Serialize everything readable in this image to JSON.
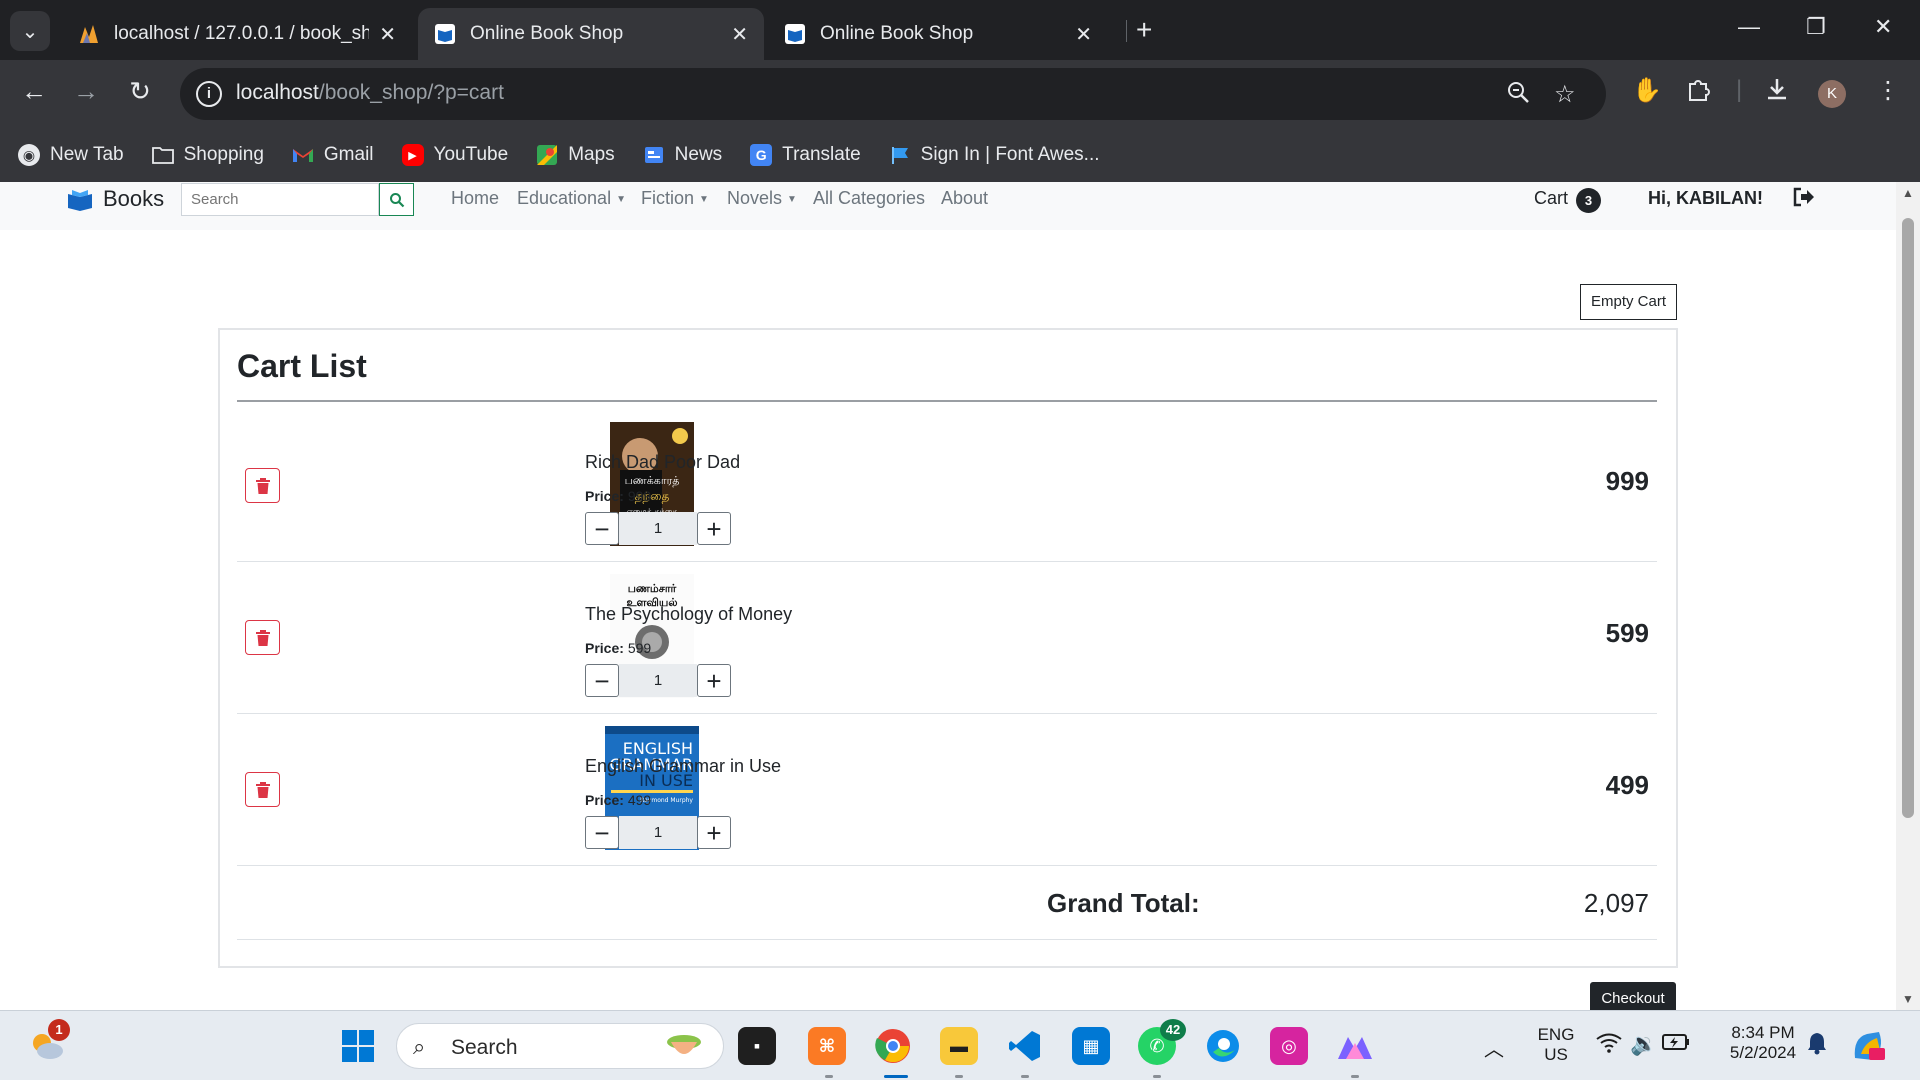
{
  "browser": {
    "tabs": [
      {
        "title": "localhost / 127.0.0.1 / book_sho",
        "favicon": "phpmyadmin-icon",
        "active": false
      },
      {
        "title": "Online Book Shop",
        "favicon": "book-shop-icon",
        "active": true
      },
      {
        "title": "Online Book Shop",
        "favicon": "book-shop-icon",
        "active": false
      }
    ],
    "address": {
      "host": "localhost",
      "path": "/book_shop/?p=cart"
    },
    "profile_initial": "K",
    "bookmarks": [
      {
        "label": "New Tab",
        "icon": "chrome-icon"
      },
      {
        "label": "Shopping",
        "icon": "folder-icon"
      },
      {
        "label": "Gmail",
        "icon": "gmail-icon"
      },
      {
        "label": "YouTube",
        "icon": "youtube-icon"
      },
      {
        "label": "Maps",
        "icon": "maps-icon"
      },
      {
        "label": "News",
        "icon": "news-icon"
      },
      {
        "label": "Translate",
        "icon": "translate-icon"
      },
      {
        "label": "Sign In | Font Awes...",
        "icon": "flag-icon"
      }
    ]
  },
  "site": {
    "brand": "Books",
    "search_placeholder": "Search",
    "nav": [
      {
        "label": "Home",
        "dropdown": false
      },
      {
        "label": "Educational",
        "dropdown": true
      },
      {
        "label": "Fiction",
        "dropdown": true
      },
      {
        "label": "Novels",
        "dropdown": true
      },
      {
        "label": "All Categories",
        "dropdown": false
      },
      {
        "label": "About",
        "dropdown": false
      }
    ],
    "cart_label": "Cart",
    "cart_count": "3",
    "greeting": "Hi, KABILAN!",
    "accent": "#198754",
    "danger": "#dc3545"
  },
  "cart": {
    "empty_button": "Empty Cart",
    "title": "Cart List",
    "items": [
      {
        "name": "Rich Dad Poor Dad",
        "price_label": "Price:",
        "price": "999",
        "qty": "1",
        "total": "999",
        "cover_lines": [
          "பணக்காரத்",
          "தந்தை",
          "ஏழைத் தந்தை"
        ]
      },
      {
        "name": "The Psychology of Money",
        "price_label": "Price:",
        "price": "599",
        "qty": "1",
        "total": "599",
        "cover_lines": [
          "பணம்சார்",
          "உளவியல்"
        ]
      },
      {
        "name": "English Grammar in Use",
        "price_label": "Price:",
        "price": "499",
        "qty": "1",
        "total": "499",
        "cover_lines": [
          "ENGLISH",
          "GRAMMAR",
          "IN USE",
          "Raymond Murphy"
        ]
      }
    ],
    "grand_total_label": "Grand Total:",
    "grand_total": "2,097",
    "checkout_button": "Checkout"
  },
  "taskbar": {
    "search_label": "Search",
    "weather_badge": "1",
    "whatsapp_badge": "42",
    "language": "ENG",
    "region": "US",
    "time": "8:34 PM",
    "date": "5/2/2024"
  }
}
